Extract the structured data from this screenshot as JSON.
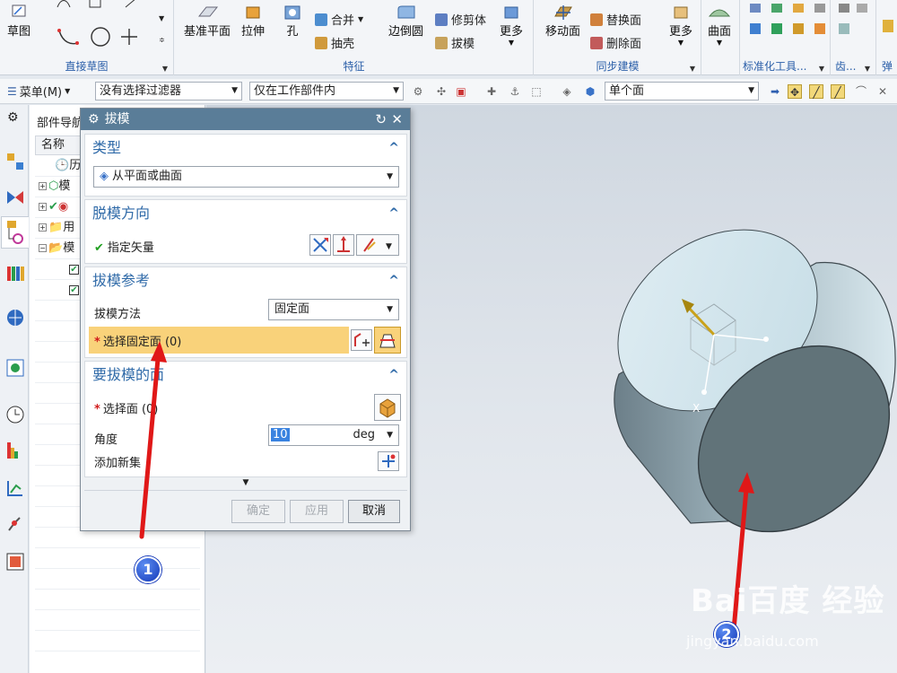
{
  "ribbon": {
    "groups": {
      "direct_sketch": {
        "label": "直接草图",
        "sketch_label": "草图"
      },
      "feature": {
        "label": "特征",
        "datum_plane": "基准平面",
        "extrude": "拉伸",
        "hole": "孔",
        "unite": "合并",
        "shell": "抽壳",
        "edge_blend": "边倒圆",
        "trim_body": "修剪体",
        "draft": "拔模",
        "more": "更多"
      },
      "sync_modeling": {
        "label": "同步建模",
        "move_face": "移动面",
        "replace_face": "替换面",
        "delete_face": "删除面",
        "more": "更多"
      },
      "surface": {
        "label": "曲面"
      },
      "standard_parts": {
        "label": "标准化工具..."
      },
      "gear": {
        "label": "齿..."
      },
      "spring": {
        "label": "弹"
      }
    }
  },
  "toolbar": {
    "menu": "菜单(M)",
    "filter": "没有选择过滤器",
    "scope": "仅在工作部件内",
    "selection_mode": "单个面"
  },
  "navigator": {
    "title": "部件导航器",
    "column_name": "名称",
    "rows": [
      "历",
      "模",
      "",
      "用",
      "模",
      "",
      ""
    ]
  },
  "dialog": {
    "title": "拔模",
    "type_section": {
      "title": "类型",
      "value": "从平面或曲面"
    },
    "direction_section": {
      "title": "脱模方向",
      "specify_vector": "指定矢量"
    },
    "reference_section": {
      "title": "拔模参考",
      "method_label": "拔模方法",
      "method_value": "固定面",
      "select_fixed_face": "选择固定面 (0)"
    },
    "faces_section": {
      "title": "要拔模的面",
      "select_face": "选择面 (0)",
      "angle_label": "角度",
      "angle_value": "10",
      "angle_unit": "deg",
      "add_new_set": "添加新集"
    },
    "buttons": {
      "ok": "确定",
      "apply": "应用",
      "cancel": "取消"
    }
  },
  "annotations": {
    "badge1": "1",
    "badge2": "2"
  },
  "viewport": {
    "axis_label": "X"
  },
  "watermark": {
    "main": "Bai百度 经验",
    "sub": "jingyan.baidu.com"
  },
  "colors": {
    "title_bar": "#5a7d98",
    "section_title": "#2f6aa8",
    "highlight_row": "#f9d27a",
    "required": "#d11b1b",
    "arrow": "#e01818",
    "badge": "#1438b8"
  }
}
